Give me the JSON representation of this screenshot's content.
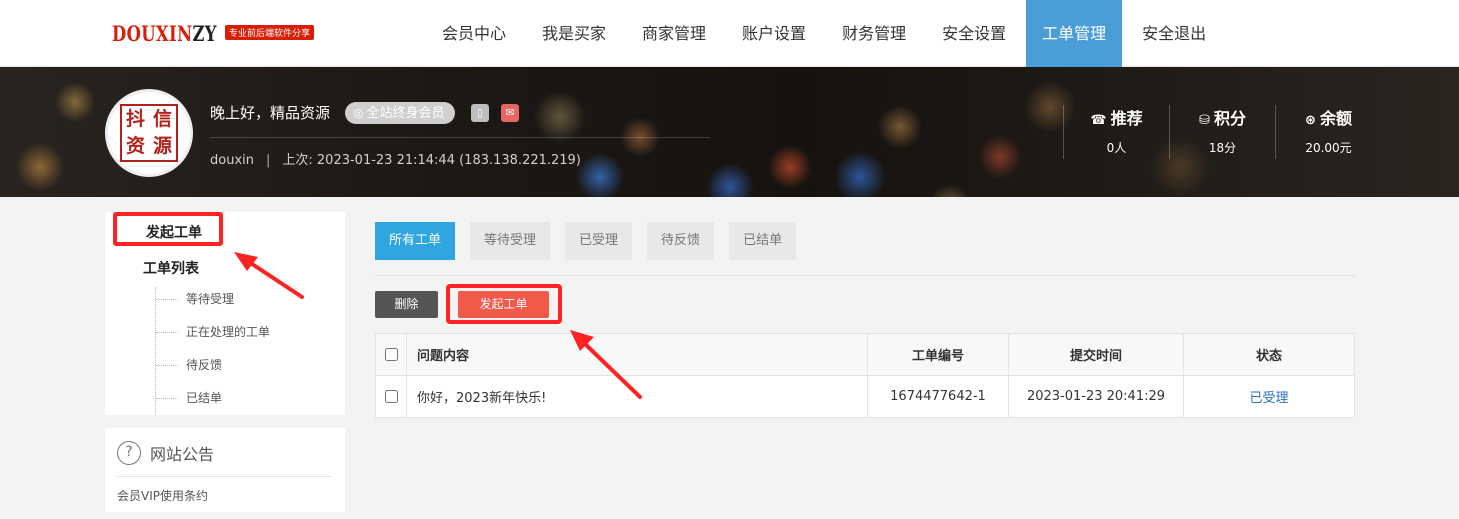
{
  "header": {
    "logo_text_a": "DOUXIN",
    "logo_text_b": "ZY",
    "logo_tagline": "专业前后端软件分享",
    "nav": [
      "会员中心",
      "我是买家",
      "商家管理",
      "账户设置",
      "财务管理",
      "安全设置",
      "工单管理",
      "安全退出"
    ],
    "active_nav": "工单管理"
  },
  "profile": {
    "avatar_chars": [
      "抖",
      "信",
      "资",
      "源"
    ],
    "greeting": "晚上好，精品资源",
    "member_badge": "全站终身会员",
    "username": "douxin",
    "last_login_label": "上次: 2023-01-23 21:14:44 (183.138.221.219)",
    "stats": [
      {
        "icon": "phone-icon",
        "title": "推荐",
        "value": "0人"
      },
      {
        "icon": "database-icon",
        "title": "积分",
        "value": "18分"
      },
      {
        "icon": "coin-icon",
        "title": "余额",
        "value": "20.00元"
      }
    ]
  },
  "sidebar": {
    "active_item": "发起工单",
    "list_title": "工单列表",
    "sub_items": [
      "等待受理",
      "正在处理的工单",
      "待反馈",
      "已结单"
    ]
  },
  "notice": {
    "title": "网站公告",
    "link": "会员VIP使用条约"
  },
  "tabs": [
    "所有工单",
    "等待受理",
    "已受理",
    "待反馈",
    "已结单"
  ],
  "active_tab": "所有工单",
  "actions": {
    "delete": "删除",
    "new_ticket": "发起工单"
  },
  "table": {
    "headers": {
      "content": "问题内容",
      "id": "工单编号",
      "time": "提交时间",
      "status": "状态"
    },
    "rows": [
      {
        "content": "你好，2023新年快乐!",
        "id": "1674477642-1",
        "time": "2023-01-23 20:41:29",
        "status": "已受理"
      }
    ]
  },
  "colors": {
    "accent": "#4a9dd6",
    "tab_active": "#2fa6e0",
    "primary_button": "#f15a4a",
    "annotation": "#ff2222"
  }
}
